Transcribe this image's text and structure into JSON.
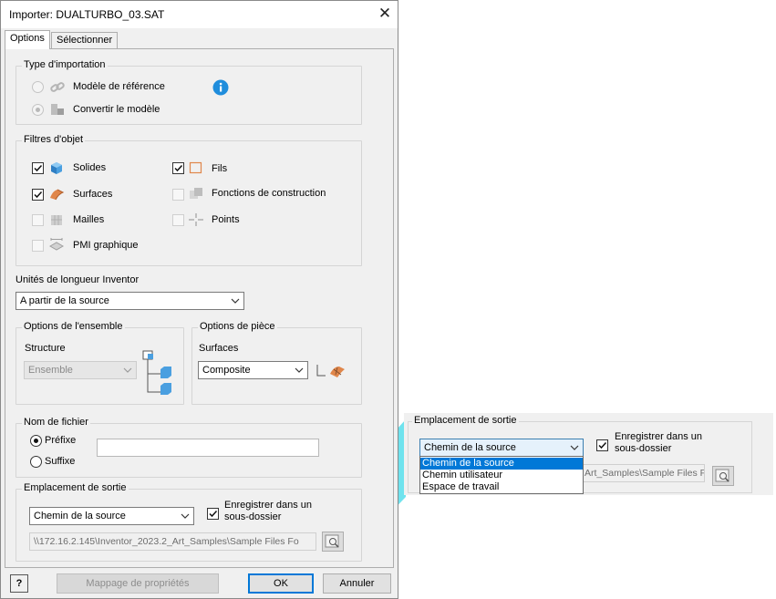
{
  "window": {
    "title": "Importer: DUALTURBO_03.SAT",
    "close_glyph": "✕"
  },
  "tabs": [
    {
      "label": "Options",
      "active": true
    },
    {
      "label": "Sélectionner",
      "active": false
    }
  ],
  "import_type": {
    "title": "Type d'importation",
    "options": [
      {
        "label": "Modèle de référence",
        "selected": false
      },
      {
        "label": "Convertir le modèle",
        "selected": true
      }
    ],
    "info_icon": "info-icon"
  },
  "object_filters": {
    "title": "Filtres d'objet",
    "items": [
      {
        "label": "Solides",
        "checked": true,
        "icon": "solid-icon"
      },
      {
        "label": "Surfaces",
        "checked": true,
        "icon": "surface-icon"
      },
      {
        "label": "Mailles",
        "checked": false,
        "icon": "mesh-icon"
      },
      {
        "label": "PMI graphique",
        "checked": false,
        "icon": "pmi-icon"
      },
      {
        "label": "Fils",
        "checked": true,
        "icon": "wire-icon"
      },
      {
        "label": "Fonctions de construction",
        "checked": false,
        "icon": "construction-icon"
      },
      {
        "label": "Points",
        "checked": false,
        "icon": "points-icon"
      }
    ]
  },
  "units": {
    "label": "Unités de longueur Inventor",
    "value": "A partir de la source"
  },
  "assembly_options": {
    "title": "Options de l'ensemble",
    "structure_label": "Structure",
    "structure_value": "Ensemble"
  },
  "part_options": {
    "title": "Options de pièce",
    "surfaces_label": "Surfaces",
    "surfaces_value": "Composite"
  },
  "filename": {
    "title": "Nom de fichier",
    "options": [
      {
        "label": "Préfixe",
        "selected": true
      },
      {
        "label": "Suffixe",
        "selected": false
      }
    ],
    "value": ""
  },
  "output": {
    "title": "Emplacement de sortie",
    "location_value": "Chemin de la source",
    "subfolder_label_1": "Enregistrer dans un",
    "subfolder_label_2": "sous-dossier",
    "subfolder_checked": true,
    "path": "\\\\172.16.2.145\\Inventor_2023.2_Art_Samples\\Sample Files Fo"
  },
  "footer": {
    "help": "?",
    "mapping_button": "Mappage de propriétés",
    "ok_button": "OK",
    "cancel_button": "Annuler"
  },
  "callout": {
    "title": "Emplacement de sortie",
    "location_value": "Chemin de la source",
    "subfolder_label_1": "Enregistrer dans un",
    "subfolder_label_2": "sous-dossier",
    "path_fragment": "Art_Samples\\Sample Files Fo",
    "dropdown_options": [
      "Chemin de la source",
      "Chemin utilisateur",
      "Espace de travail"
    ],
    "selected_index": 0
  },
  "colors": {
    "accent": "#0078d7",
    "highlight_callout": "#6fe3ee",
    "info_blue": "#1f8ddc"
  }
}
